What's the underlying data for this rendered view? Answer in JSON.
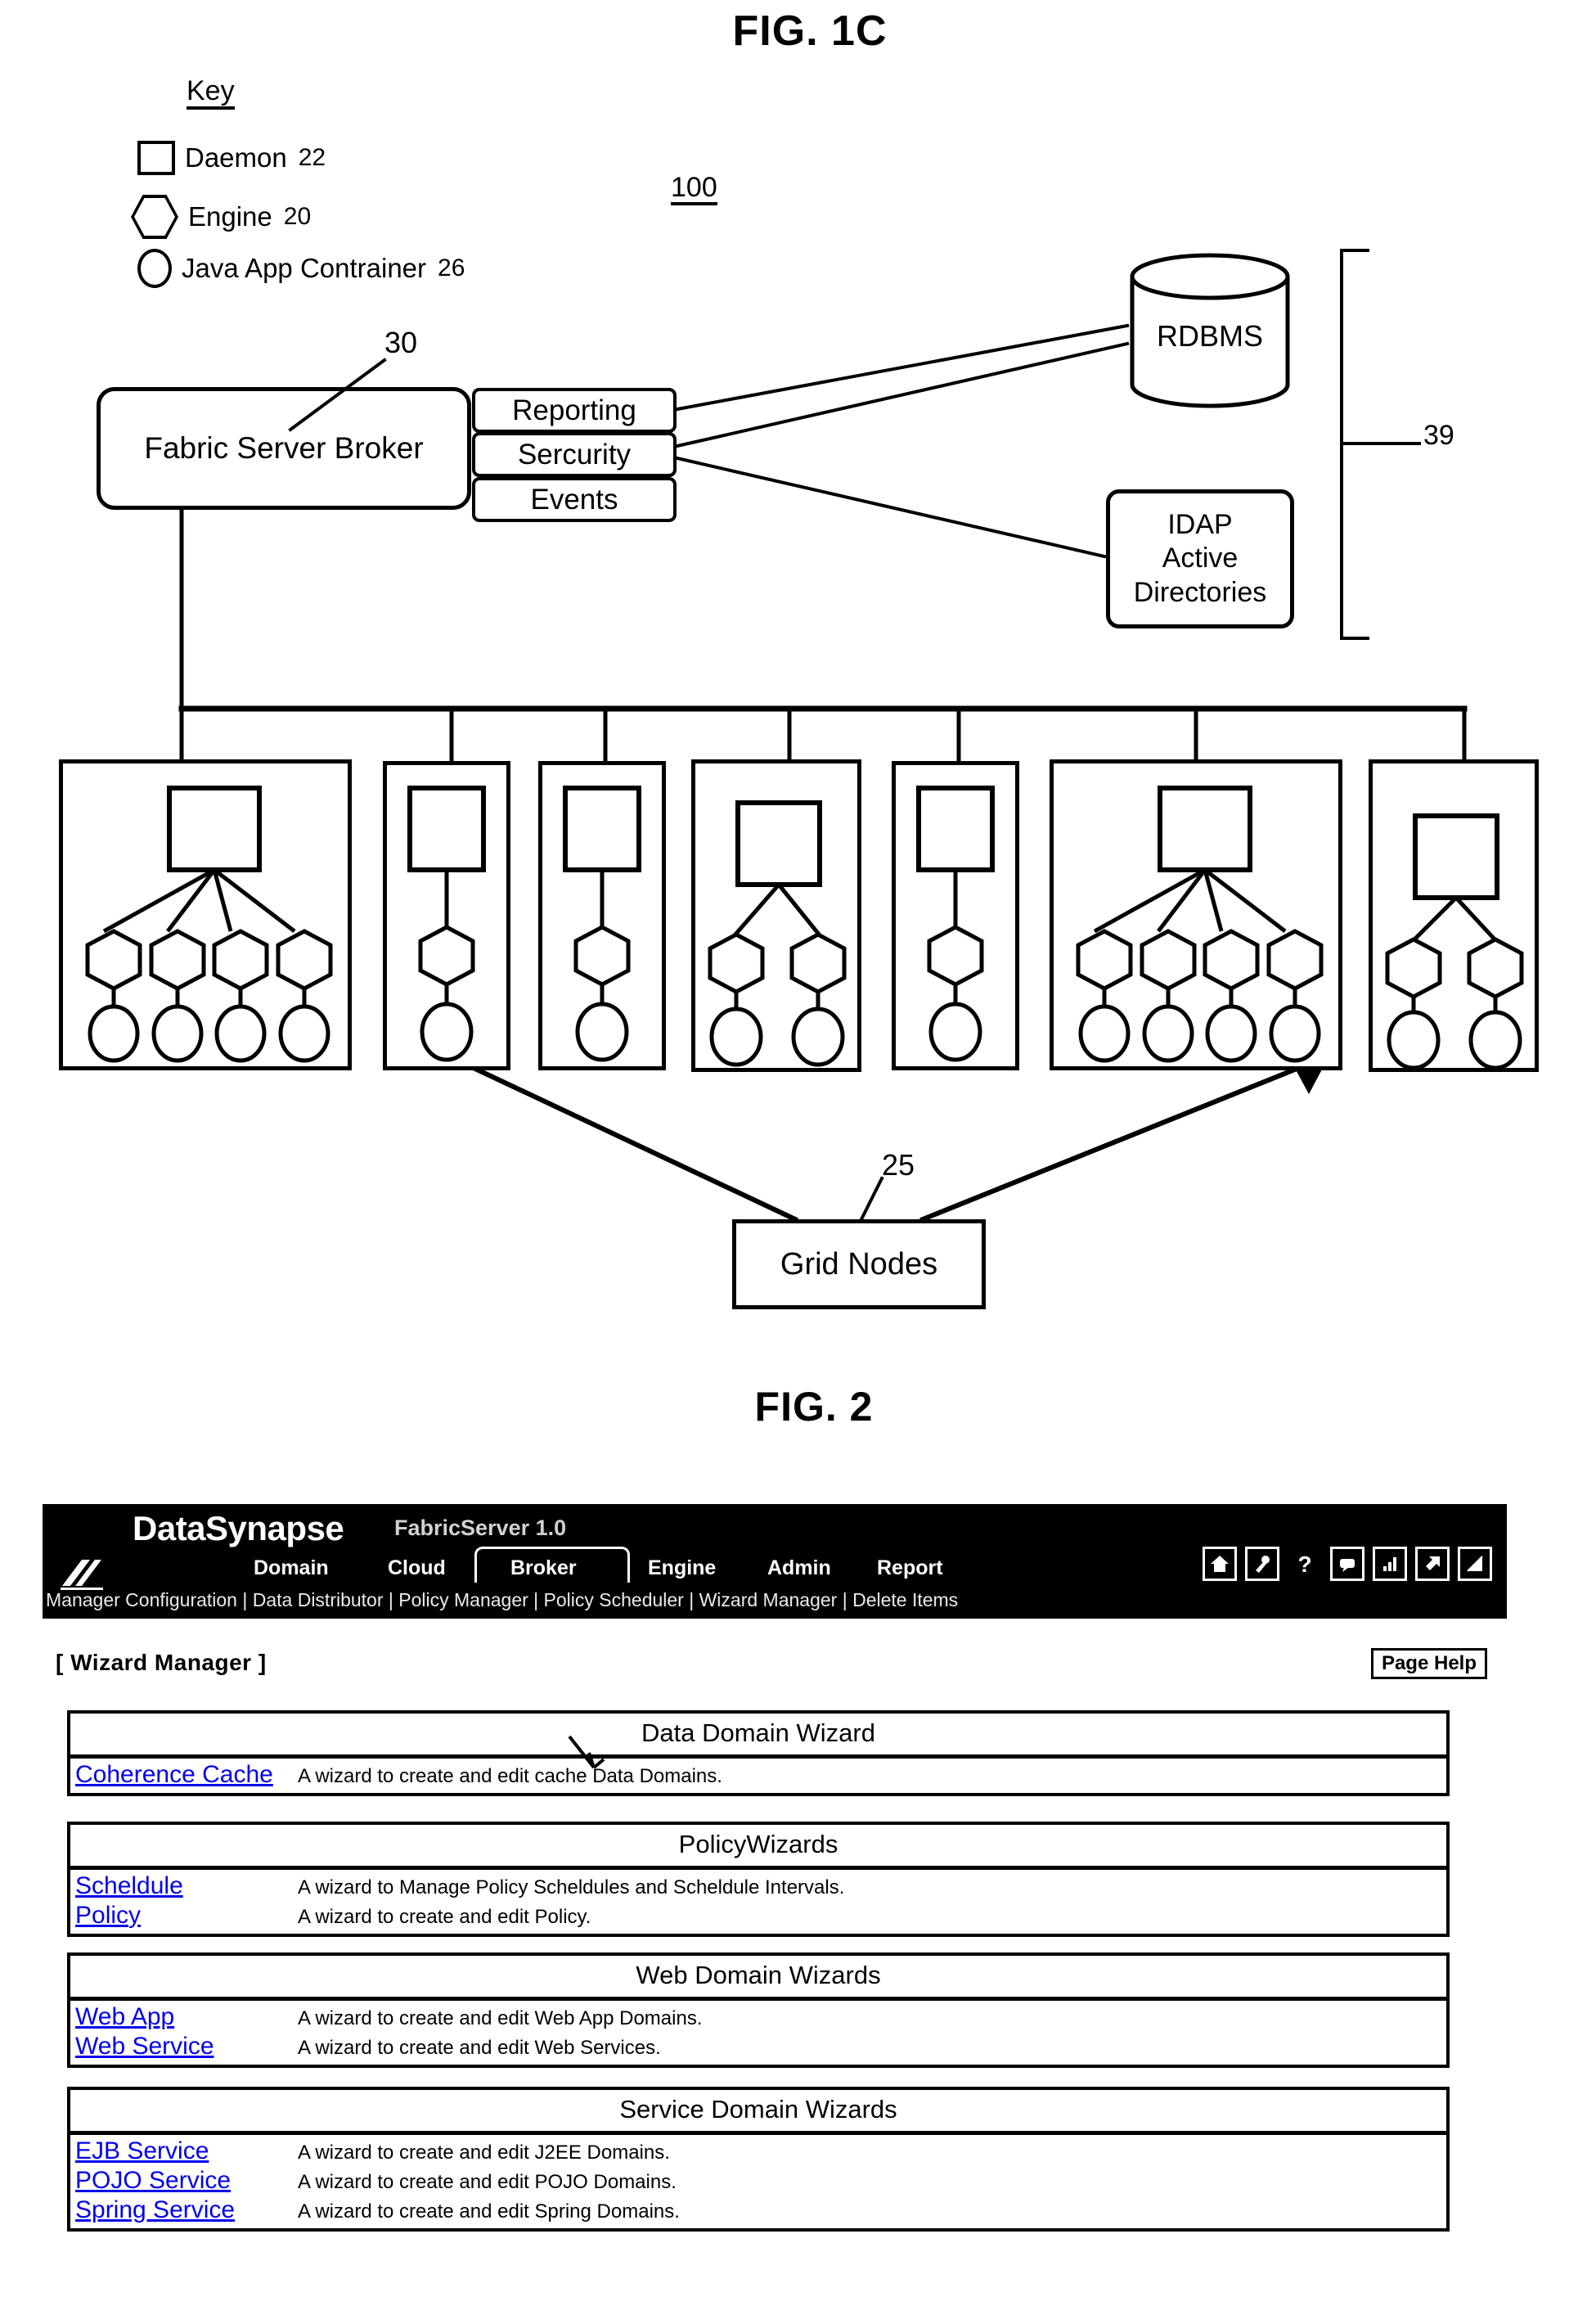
{
  "figures": {
    "fig1c_title": "FIG. 1C",
    "fig2_title": "FIG. 2"
  },
  "fig1c": {
    "key_title": "Key",
    "key_items": [
      {
        "shape": "square",
        "label": "Daemon",
        "ref": "22"
      },
      {
        "shape": "hexagon",
        "label": "Engine",
        "ref": "20"
      },
      {
        "shape": "circle",
        "label": "Java App Contrainer",
        "ref": "26"
      }
    ],
    "system_ref": "100",
    "broker": {
      "label": "Fabric Server Broker",
      "ref": "30"
    },
    "services": [
      "Reporting",
      "Sercurity",
      "Events"
    ],
    "rdbms": {
      "label": "RDBMS"
    },
    "ldap": {
      "lines": [
        "IDAP",
        "Active",
        "Directories"
      ]
    },
    "backend_group_ref": "39",
    "grid_nodes_label": "Grid Nodes",
    "grid_nodes_ref": "25",
    "nodes": [
      {
        "engines": 4,
        "wide": true
      },
      {
        "engines": 1,
        "wide": false
      },
      {
        "engines": 1,
        "wide": false
      },
      {
        "engines": 2,
        "wide": false
      },
      {
        "engines": 1,
        "wide": false
      },
      {
        "engines": 4,
        "wide": true
      },
      {
        "engines": 2,
        "wide": false
      }
    ]
  },
  "fig2": {
    "brand": "DataSynapse",
    "product": "FabricServer 1.0",
    "logo_icon": "datasynapse-logo-icon",
    "tabs": [
      {
        "label": "Domain",
        "active": false
      },
      {
        "label": "Cloud",
        "active": false
      },
      {
        "label": "Broker",
        "active": true
      },
      {
        "label": "Engine",
        "active": false
      },
      {
        "label": "Admin",
        "active": false
      },
      {
        "label": "Report",
        "active": false
      }
    ],
    "subnav": "Manager Configuration | Data Distributor | Policy Manager | Policy Scheduler | Wizard Manager | Delete Items",
    "toolbar_icons": [
      "home-icon",
      "key-icon",
      "help-icon",
      "console-icon",
      "chart-icon",
      "launch-icon",
      "toggle-icon"
    ],
    "page_label": "[ Wizard Manager ]",
    "page_help_label": "Page Help",
    "sections": [
      {
        "title": "Data Domain Wizard",
        "rows": [
          {
            "link": "Coherence Cache",
            "desc": "A wizard to create and edit cache Data Domains."
          }
        ]
      },
      {
        "title": "PolicyWizards",
        "rows": [
          {
            "link": "Scheldule",
            "desc": "A wizard to Manage Policy Scheldules and Scheldule Intervals."
          },
          {
            "link": "Policy",
            "desc": "A wizard to create and edit Policy."
          }
        ]
      },
      {
        "title": "Web Domain Wizards",
        "rows": [
          {
            "link": "Web App",
            "desc": "A wizard to create and edit Web App Domains."
          },
          {
            "link": "Web Service",
            "desc": "A wizard to create and edit Web Services."
          }
        ]
      },
      {
        "title": "Service Domain Wizards",
        "rows": [
          {
            "link": "EJB Service",
            "desc": "A wizard to create and edit J2EE Domains."
          },
          {
            "link": "POJO Service",
            "desc": "A wizard to create and edit POJO Domains."
          },
          {
            "link": "Spring Service",
            "desc": "A wizard to create and edit Spring Domains."
          }
        ]
      }
    ]
  },
  "colors": {
    "ink": "#000000",
    "paper": "#ffffff",
    "header_bg": "#000000",
    "header_fg": "#ffffff"
  }
}
